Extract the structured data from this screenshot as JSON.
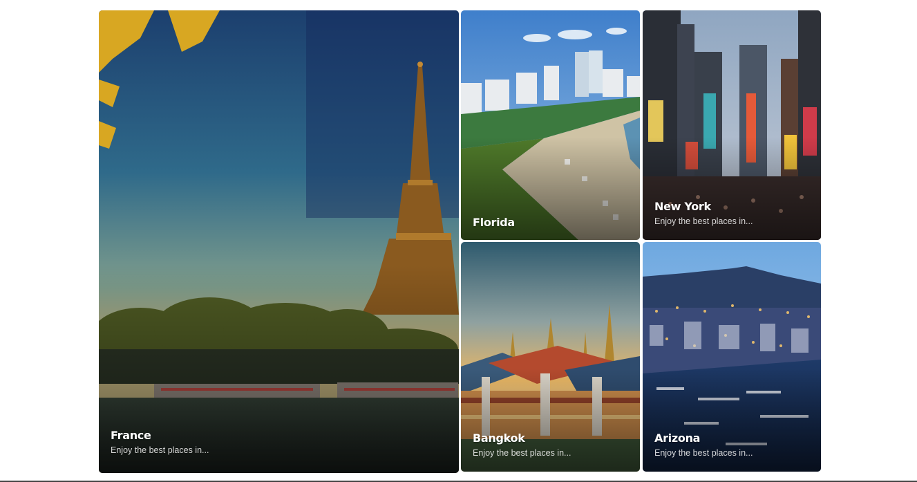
{
  "destinations": [
    {
      "title": "France",
      "subtitle": "Enjoy the best places in..."
    },
    {
      "title": "Florida",
      "subtitle": ""
    },
    {
      "title": "New York",
      "subtitle": "Enjoy the best places in..."
    },
    {
      "title": "Bangkok",
      "subtitle": "Enjoy the best places in..."
    },
    {
      "title": "Arizona",
      "subtitle": "Enjoy the best places in..."
    }
  ],
  "image_subjects": {
    "france": "eiffel-tower-river-seine",
    "florida": "miami-beach-skyline",
    "newyork": "times-square-street",
    "bangkok": "temple-sunset",
    "arizona": "harbor-city-night"
  }
}
